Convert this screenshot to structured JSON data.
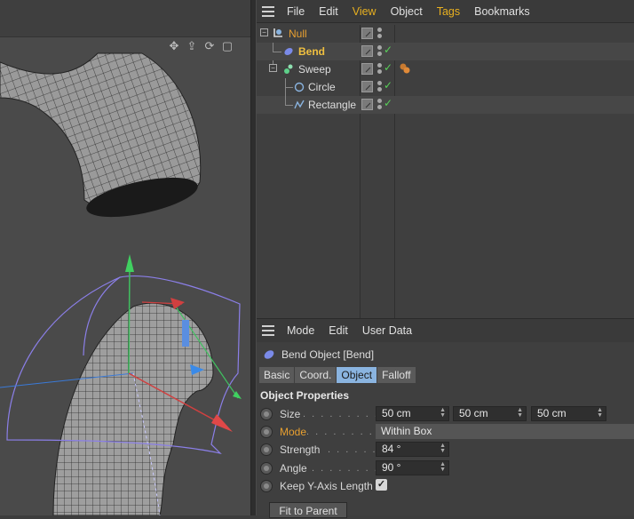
{
  "object_manager": {
    "menu": [
      "File",
      "Edit",
      "View",
      "Object",
      "Tags",
      "Bookmarks"
    ],
    "highlighted_menu": [
      "View",
      "Tags"
    ],
    "objects": [
      {
        "name": "Null",
        "color": "orange",
        "icon": "null-object-icon"
      },
      {
        "name": "Bend",
        "color": "yellow",
        "icon": "bend-deformer-icon"
      },
      {
        "name": "Sweep",
        "color": "default",
        "icon": "sweep-nurbs-icon"
      },
      {
        "name": "Circle",
        "color": "default",
        "icon": "circle-spline-icon"
      },
      {
        "name": "Rectangle",
        "color": "default",
        "icon": "rectangle-spline-icon"
      }
    ]
  },
  "attribute_manager": {
    "menu": [
      "Mode",
      "Edit",
      "User Data"
    ],
    "title": "Bend Object [Bend]",
    "tabs": [
      "Basic",
      "Coord.",
      "Object",
      "Falloff"
    ],
    "active_tab": "Object",
    "section": "Object Properties",
    "size_label": "Size",
    "size_values": [
      "50 cm",
      "50 cm",
      "50 cm"
    ],
    "mode_label": "Mode",
    "mode_value": "Within Box",
    "strength_label": "Strength",
    "strength_value": "84 °",
    "angle_label": "Angle",
    "angle_value": "90 °",
    "keep_label": "Keep Y-Axis Length",
    "keep_checked": true,
    "fit_button": "Fit to Parent"
  },
  "colors": {
    "accent_orange": "#e8a030",
    "accent_yellow": "#f0c040",
    "check_green": "#58d058",
    "active_tab": "#8ab4e0"
  }
}
